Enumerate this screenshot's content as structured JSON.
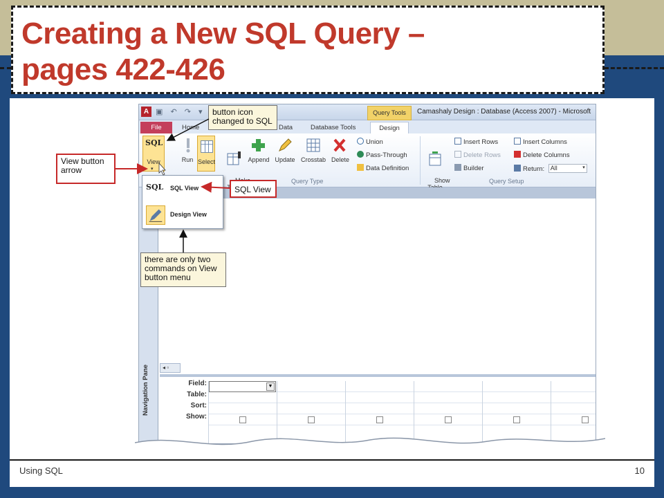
{
  "slide": {
    "title_line1": "Creating a New SQL Query –",
    "title_line2": "pages 422-426",
    "footer_left": "Using SQL",
    "footer_right": "10"
  },
  "colors": {
    "background": "#1f497d",
    "band": "#c5be99",
    "title": "#c0392b",
    "callout_red": "#c62828"
  },
  "access": {
    "app_icon": "A",
    "qat": "▣ ↶ ↷ ▾",
    "context_tab": "Query Tools",
    "window_title": "Camashaly Design : Database (Access 2007) - Microsoft",
    "tabs": [
      "File",
      "Home",
      "Data",
      "Database Tools",
      "Design"
    ],
    "ribbon": {
      "view_icon": "SQL",
      "view_label": "View",
      "run_label": "Run",
      "select_label": "Select",
      "make_table_label": "Make\nTable",
      "append_label": "Append",
      "update_label": "Update",
      "crosstab_label": "Crosstab",
      "delete_label": "Delete",
      "union": "Union",
      "pass_through": "Pass-Through",
      "data_definition": "Data Definition",
      "show_table": "Show\nTable",
      "insert_rows": "Insert Rows",
      "delete_rows": "Delete Rows",
      "builder": "Builder",
      "insert_columns": "Insert Columns",
      "delete_columns": "Delete Columns",
      "return_label": "Return:",
      "return_value": "All",
      "group_query_type": "Query Type",
      "group_query_setup": "Query Setup"
    },
    "menu": {
      "sql_icon": "SQL",
      "sql_view": "SQL View",
      "design_view": "Design View"
    },
    "nav_pane": "Navigation Pane",
    "grid_rows": [
      "Field:",
      "Table:",
      "Sort:",
      "Show:"
    ]
  },
  "callouts": {
    "button_icon": "button icon changed to SQL",
    "view_arrow": "View button arrow",
    "sql_view": "SQL View",
    "two_commands": "there are only two commands on View button menu"
  }
}
